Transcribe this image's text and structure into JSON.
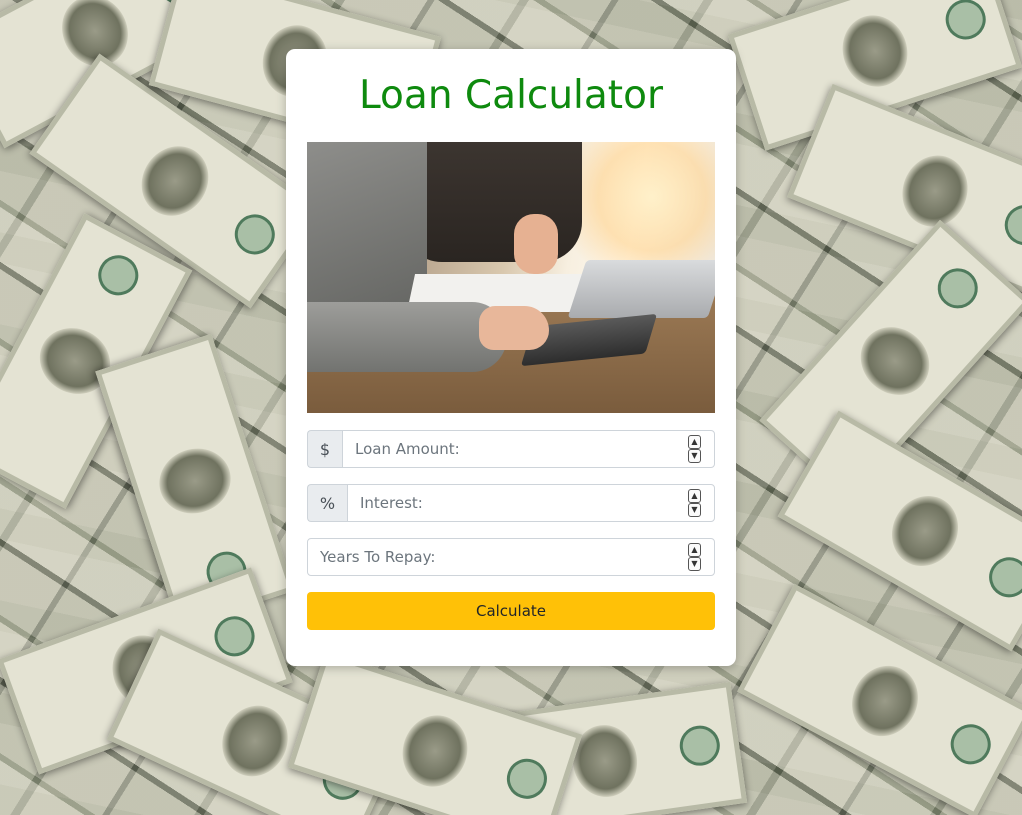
{
  "app": {
    "title": "Loan Calculator"
  },
  "form": {
    "loan_amount": {
      "addon": "$",
      "placeholder": "Loan Amount:",
      "value": ""
    },
    "interest": {
      "addon": "%",
      "placeholder": "Interest:",
      "value": ""
    },
    "years": {
      "placeholder": "Years To Repay:",
      "value": ""
    },
    "submit_label": "Calculate"
  },
  "spinner": {
    "up": "▲",
    "down": "▼"
  },
  "icons": {
    "background": "money-background-image",
    "hero": "business-calculation-photo"
  },
  "colors": {
    "title": "#0e8a0e",
    "button": "#ffc107",
    "card": "#ffffff"
  }
}
